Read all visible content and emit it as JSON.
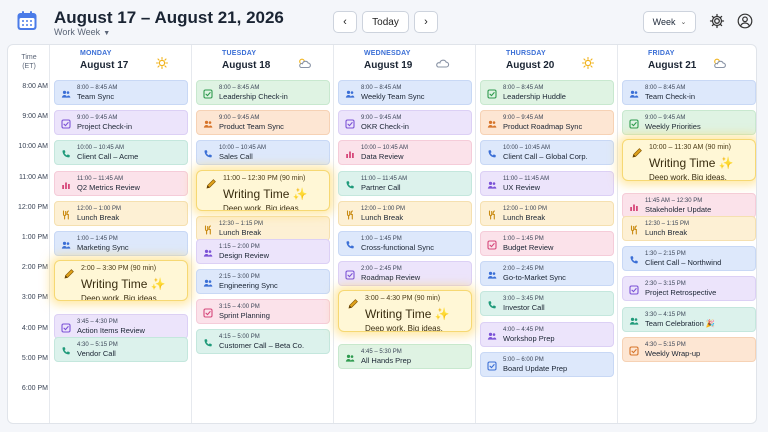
{
  "header": {
    "title": "August 17 – August 21, 2026",
    "subtitle": "Work Week",
    "prev_label": "‹",
    "today_label": "Today",
    "next_label": "›",
    "view_label": "Week"
  },
  "icons": {
    "logo": "calendar-icon",
    "settings": "gear-icon",
    "account": "user-icon"
  },
  "time_column": {
    "title": "Time",
    "zone": "(ET)",
    "labels": [
      "8:00 AM",
      "9:00 AM",
      "10:00 AM",
      "11:00 AM",
      "12:00 PM",
      "1:00 PM",
      "2:00 PM",
      "3:00 PM",
      "4:00 PM",
      "5:00 PM",
      "6:00 PM"
    ]
  },
  "days": [
    {
      "name": "MONDAY",
      "date": "August 17",
      "weather": "sun",
      "events": [
        {
          "time": "8:00 – 8:45 AM",
          "title": "Team Sync",
          "color": "blue",
          "icon": "people"
        },
        {
          "time": "9:00 – 9:45 AM",
          "title": "Project Check-in",
          "color": "purple",
          "icon": "check"
        },
        {
          "time": "10:00 – 10:45 AM",
          "title": "Client Call – Acme",
          "color": "teal",
          "icon": "phone"
        },
        {
          "time": "11:00 – 11:45 AM",
          "title": "Q2 Metrics Review",
          "color": "pink",
          "icon": "chart"
        },
        {
          "time": "12:00 – 1:00 PM",
          "title": "Lunch Break",
          "color": "yellow",
          "icon": "fork"
        },
        {
          "time": "1:00 – 1:45 PM",
          "title": "Marketing Sync",
          "color": "blue",
          "icon": "people"
        },
        {
          "time": "3:45 – 4:30 PM",
          "title": "Action Items Review",
          "color": "purple",
          "icon": "check"
        },
        {
          "time": "4:30 – 5:15 PM",
          "title": "Vendor Call",
          "color": "teal",
          "icon": "phone"
        }
      ],
      "writing": {
        "time": "2:00 – 3:30 PM (90 min)",
        "title": "Writing Time ✨",
        "subtitle": "Deep work. Big ideas."
      }
    },
    {
      "name": "TUESDAY",
      "date": "August 18",
      "weather": "partly-cloudy",
      "events": [
        {
          "time": "8:00 – 8:45 AM",
          "title": "Leadership Check-in",
          "color": "green",
          "icon": "check"
        },
        {
          "time": "9:00 – 9:45 AM",
          "title": "Product Team Sync",
          "color": "orange",
          "icon": "people"
        },
        {
          "time": "10:00 – 10:45 AM",
          "title": "Sales Call",
          "color": "blue",
          "icon": "phone"
        },
        {
          "time": "12:30 – 1:15 PM",
          "title": "Lunch Break",
          "color": "yellow",
          "icon": "fork"
        },
        {
          "time": "1:15 – 2:00 PM",
          "title": "Design Review",
          "color": "purple",
          "icon": "people"
        },
        {
          "time": "2:15 – 3:00 PM",
          "title": "Engineering Sync",
          "color": "blue",
          "icon": "people"
        },
        {
          "time": "3:15 – 4:00 PM",
          "title": "Sprint Planning",
          "color": "pink",
          "icon": "check"
        },
        {
          "time": "4:15 – 5:00 PM",
          "title": "Customer Call – Beta Co.",
          "color": "teal",
          "icon": "phone"
        }
      ],
      "writing": {
        "time": "11:00 – 12:30 PM (90 min)",
        "title": "Writing Time ✨",
        "subtitle": "Deep work. Big ideas."
      }
    },
    {
      "name": "WEDNESDAY",
      "date": "August 19",
      "weather": "cloud",
      "events": [
        {
          "time": "8:00 – 8:45 AM",
          "title": "Weekly Team Sync",
          "color": "blue",
          "icon": "people"
        },
        {
          "time": "9:00 – 9:45 AM",
          "title": "OKR Check-in",
          "color": "purple",
          "icon": "check"
        },
        {
          "time": "10:00 – 10:45 AM",
          "title": "Data Review",
          "color": "pink",
          "icon": "chart"
        },
        {
          "time": "11:00 – 11:45 AM",
          "title": "Partner Call",
          "color": "teal",
          "icon": "phone"
        },
        {
          "time": "12:00 – 1:00 PM",
          "title": "Lunch Break",
          "color": "yellow",
          "icon": "fork"
        },
        {
          "time": "1:00 – 1:45 PM",
          "title": "Cross-functional Sync",
          "color": "blue",
          "icon": "phone"
        },
        {
          "time": "2:00 – 2:45 PM",
          "title": "Roadmap Review",
          "color": "purple",
          "icon": "check"
        },
        {
          "time": "4:45 – 5:30 PM",
          "title": "All Hands Prep",
          "color": "green",
          "icon": "people"
        }
      ],
      "writing": {
        "time": "3:00 – 4:30 PM (90 min)",
        "title": "Writing Time ✨",
        "subtitle": "Deep work. Big ideas."
      }
    },
    {
      "name": "THURSDAY",
      "date": "August 20",
      "weather": "sun",
      "events": [
        {
          "time": "8:00 – 8:45 AM",
          "title": "Leadership Huddle",
          "color": "green",
          "icon": "check"
        },
        {
          "time": "9:00 – 9:45 AM",
          "title": "Product Roadmap Sync",
          "color": "orange",
          "icon": "people"
        },
        {
          "time": "10:00 – 10:45 AM",
          "title": "Client Call – Global Corp.",
          "color": "blue",
          "icon": "phone"
        },
        {
          "time": "11:00 – 11:45 AM",
          "title": "UX Review",
          "color": "purple",
          "icon": "people"
        },
        {
          "time": "12:00 – 1:00 PM",
          "title": "Lunch Break",
          "color": "yellow",
          "icon": "fork"
        },
        {
          "time": "1:00 – 1:45 PM",
          "title": "Budget Review",
          "color": "pink",
          "icon": "check"
        },
        {
          "time": "2:00 – 2:45 PM",
          "title": "Go-to-Market Sync",
          "color": "blue",
          "icon": "people"
        },
        {
          "time": "3:00 – 3:45 PM",
          "title": "Investor Call",
          "color": "teal",
          "icon": "phone"
        },
        {
          "time": "4:00 – 4:45 PM",
          "title": "Workshop Prep",
          "color": "purple",
          "icon": "people"
        },
        {
          "time": "5:00 – 6:00 PM",
          "title": "Board Update Prep",
          "color": "blue",
          "icon": "check"
        }
      ]
    },
    {
      "name": "FRIDAY",
      "date": "August 21",
      "weather": "partly-cloudy",
      "events": [
        {
          "time": "8:00 – 8:45 AM",
          "title": "Team Check-in",
          "color": "blue",
          "icon": "people"
        },
        {
          "time": "9:00 – 9:45 AM",
          "title": "Weekly Priorities",
          "color": "green",
          "icon": "check"
        },
        {
          "time": "11:45 AM – 12:30 PM",
          "title": "Stakeholder Update",
          "color": "pink",
          "icon": "chart"
        },
        {
          "time": "12:30 – 1:15 PM",
          "title": "Lunch Break",
          "color": "yellow",
          "icon": "fork"
        },
        {
          "time": "1:30 – 2:15 PM",
          "title": "Client Call – Northwind",
          "color": "blue",
          "icon": "phone"
        },
        {
          "time": "2:30 – 3:15 PM",
          "title": "Project Retrospective",
          "color": "purple",
          "icon": "check"
        },
        {
          "time": "3:30 – 4:15 PM",
          "title": "Team Celebration 🎉",
          "color": "teal",
          "icon": "people"
        },
        {
          "time": "4:30 – 5:15 PM",
          "title": "Weekly Wrap-up",
          "color": "orange",
          "icon": "check"
        }
      ],
      "writing": {
        "time": "10:00 – 11:30 AM (90 min)",
        "title": "Writing Time ✨",
        "subtitle": "Deep work. Big ideas."
      }
    }
  ]
}
